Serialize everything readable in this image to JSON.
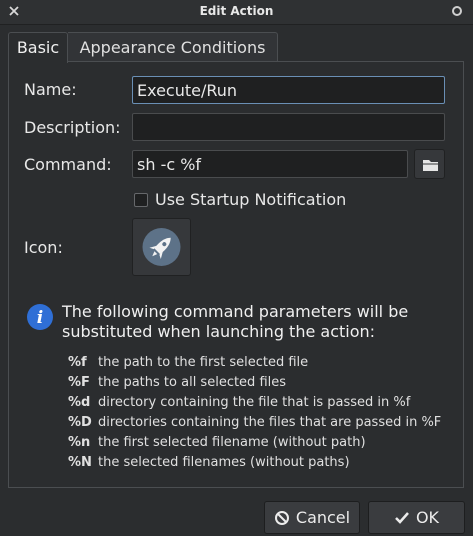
{
  "window": {
    "title": "Edit Action"
  },
  "tabs": [
    {
      "label": "Basic"
    },
    {
      "label": "Appearance Conditions"
    }
  ],
  "form": {
    "name_label": "Name:",
    "name_value": "Execute/Run",
    "description_label": "Description:",
    "description_value": "",
    "command_label": "Command:",
    "command_value": "sh -c %f",
    "startup_notification_label": "Use Startup Notification",
    "startup_notification_checked": false,
    "icon_label": "Icon:"
  },
  "info": {
    "text": "The following command parameters will be substituted when launching the action:",
    "params": [
      {
        "code": "%f",
        "desc": "the path to the first selected file"
      },
      {
        "code": "%F",
        "desc": "the paths to all selected files"
      },
      {
        "code": "%d",
        "desc": "directory containing the file that is passed in %f"
      },
      {
        "code": "%D",
        "desc": "directories containing the files that are passed in %F"
      },
      {
        "code": "%n",
        "desc": "the first selected filename (without path)"
      },
      {
        "code": "%N",
        "desc": "the selected filenames (without paths)"
      }
    ]
  },
  "buttons": {
    "cancel_label": "Cancel",
    "ok_label": "OK"
  },
  "colors": {
    "background": "#2b2d2f",
    "entry_background": "#1f2021",
    "focus_border": "#6a8fb5",
    "info_icon": "#2f6fd6",
    "rocket_circle": "#5d7288"
  }
}
